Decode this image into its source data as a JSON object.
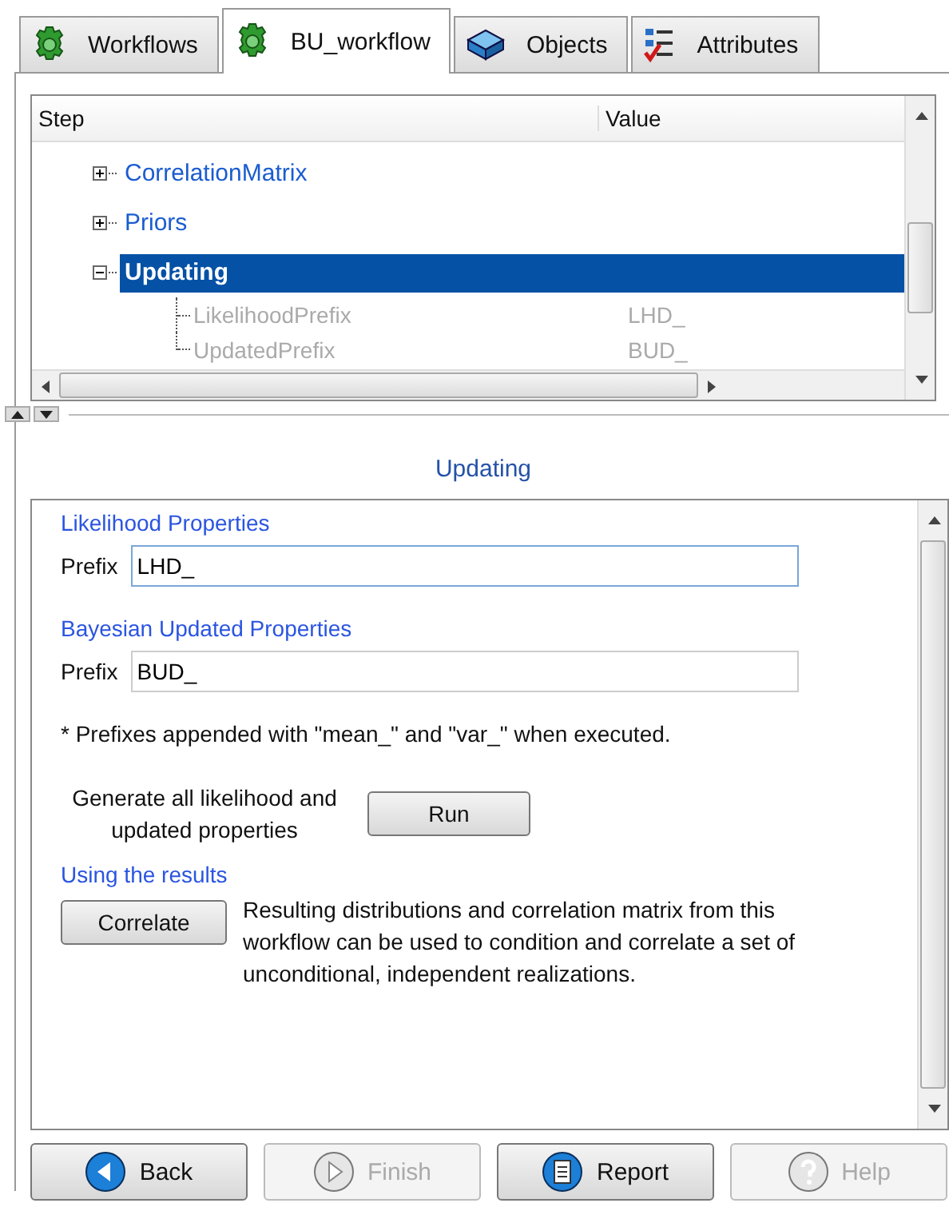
{
  "tabs": [
    {
      "label": "Workflows",
      "selected": false
    },
    {
      "label": "BU_workflow",
      "selected": true
    },
    {
      "label": "Objects",
      "selected": false
    },
    {
      "label": "Attributes",
      "selected": false
    }
  ],
  "tree": {
    "columns": [
      "Step",
      "Value"
    ],
    "items": [
      {
        "label": "CorrelationMatrix",
        "expanded": false,
        "selected": false
      },
      {
        "label": "Priors",
        "expanded": false,
        "selected": false
      },
      {
        "label": "Updating",
        "expanded": true,
        "selected": true,
        "children": [
          {
            "label": "LikelihoodPrefix",
            "value": "LHD_",
            "disabled": true
          },
          {
            "label": "UpdatedPrefix",
            "value": "BUD_",
            "disabled": true
          }
        ]
      }
    ]
  },
  "panel": {
    "title": "Updating",
    "sections": [
      {
        "kind": "field",
        "heading": "Likelihood Properties",
        "label": "Prefix",
        "value": "LHD_",
        "focused": true
      },
      {
        "kind": "field",
        "heading": "Bayesian Updated Properties",
        "label": "Prefix",
        "value": "BUD_",
        "focused": false
      },
      {
        "kind": "note",
        "text": "* Prefixes appended with \"mean_\" and \"var_\" when executed."
      },
      {
        "kind": "action",
        "text": "Generate all likelihood and updated properties",
        "button": "Run"
      },
      {
        "kind": "correlate",
        "heading": "Using the results",
        "button": "Correlate",
        "text": "Resulting distributions and correlation matrix from this workflow can be used to condition and correlate a set of unconditional, independent realizations."
      }
    ]
  },
  "buttons": [
    {
      "label": "Back",
      "disabled": false
    },
    {
      "label": "Finish",
      "disabled": true
    },
    {
      "label": "Report",
      "disabled": false
    },
    {
      "label": "Help",
      "disabled": true
    }
  ]
}
